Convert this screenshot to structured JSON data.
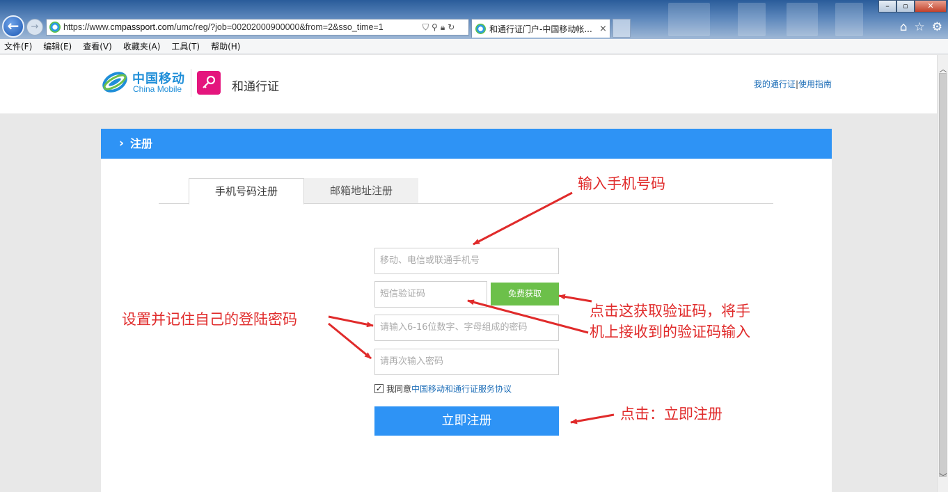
{
  "browser": {
    "url_prefix": "https://www.",
    "url_host": "cmpassport.com",
    "url_rest": "/umc/reg/?job=00202000900000&from=2&sso_time=1",
    "tab_title": "和通行证门户-中国移动帐...",
    "tab_close": "×",
    "menus": [
      "文件(F)",
      "编辑(E)",
      "查看(V)",
      "收藏夹(A)",
      "工具(T)",
      "帮助(H)"
    ],
    "win_min": "–",
    "win_max": "▫",
    "win_close": "✕"
  },
  "header": {
    "logo_cn": "中国移动",
    "logo_en": "China Mobile",
    "brand": "和通行证",
    "link_my": "我的通行证",
    "link_sep": "|",
    "link_guide": "使用指南"
  },
  "panel": {
    "title": "注册",
    "tab_phone": "手机号码注册",
    "tab_email": "邮箱地址注册",
    "phone_placeholder": "移动、电信或联通手机号",
    "sms_placeholder": "短信验证码",
    "sms_button": "免费获取",
    "password_placeholder": "请输入6-16位数字、字母组成的密码",
    "password2_placeholder": "请再次输入密码",
    "agree_prefix": "我同意",
    "agree_link": "中国移动和通行证服务协议",
    "submit": "立即注册"
  },
  "annotations": {
    "phone": "输入手机号码",
    "sms_line1": "点击这获取验证码，将手",
    "sms_line2": "机上接收到的验证码输入",
    "password": "设置并记住自己的登陆密码",
    "submit": "点击：立即注册"
  },
  "colors": {
    "primary": "#2e93f5",
    "green": "#6cc04a",
    "annotation": "#e02b2b",
    "brand_pink": "#e4157d"
  }
}
